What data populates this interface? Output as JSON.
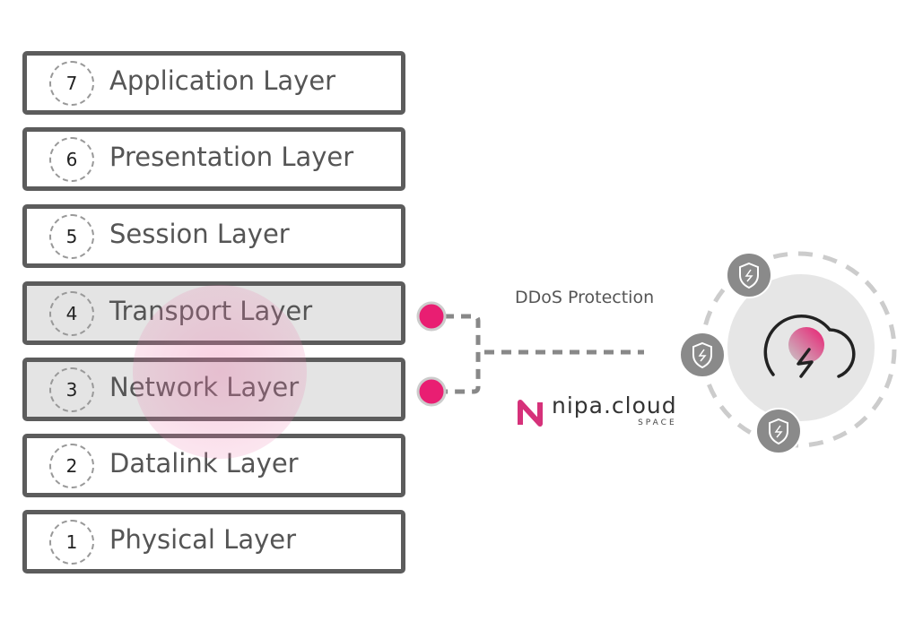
{
  "layers": [
    {
      "number": "7",
      "label": "Application Layer",
      "highlighted": false
    },
    {
      "number": "6",
      "label": "Presentation Layer",
      "highlighted": false
    },
    {
      "number": "5",
      "label": "Session Layer",
      "highlighted": false
    },
    {
      "number": "4",
      "label": "Transport Layer",
      "highlighted": true
    },
    {
      "number": "3",
      "label": "Network Layer",
      "highlighted": true
    },
    {
      "number": "2",
      "label": "Datalink Layer",
      "highlighted": false
    },
    {
      "number": "1",
      "label": "Physical Layer",
      "highlighted": false
    }
  ],
  "connector_label": "DDoS Protection",
  "logo": {
    "name": "nipa.cloud",
    "sub": "SPACE"
  },
  "icons": [
    "shield-lightning-icon",
    "cloud-lightning-icon"
  ],
  "colors": {
    "accent": "#e91e72",
    "border": "#5c5c5c",
    "highlight": "#e4e4e4",
    "shield": "#8a8a8a"
  }
}
